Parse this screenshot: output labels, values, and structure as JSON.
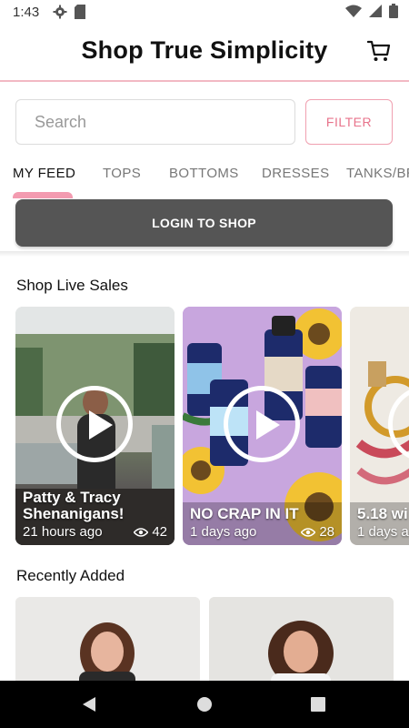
{
  "status_bar": {
    "time": "1:43"
  },
  "header": {
    "title": "Shop True Simplicity"
  },
  "search": {
    "placeholder": "Search"
  },
  "filter": {
    "label": "FILTER"
  },
  "tabs": [
    {
      "label": "MY FEED"
    },
    {
      "label": "TOPS"
    },
    {
      "label": "BOTTOMS"
    },
    {
      "label": "DRESSES"
    },
    {
      "label": "TANKS/BR"
    }
  ],
  "login": {
    "label": "LOGIN TO SHOP"
  },
  "live_sales": {
    "title": "Shop Live Sales",
    "items": [
      {
        "title": "Patty & Tracy Shenanigans!",
        "time": "21 hours ago",
        "views": "42"
      },
      {
        "title": "NO CRAP IN IT",
        "time": "1 days ago",
        "views": "28"
      },
      {
        "title": "5.18 wi",
        "time": "1 days a",
        "views": ""
      }
    ]
  },
  "recent": {
    "title": "Recently Added"
  },
  "colors": {
    "accent": "#f39bb0",
    "filter_text": "#e8738b",
    "login_bg": "#555555"
  }
}
